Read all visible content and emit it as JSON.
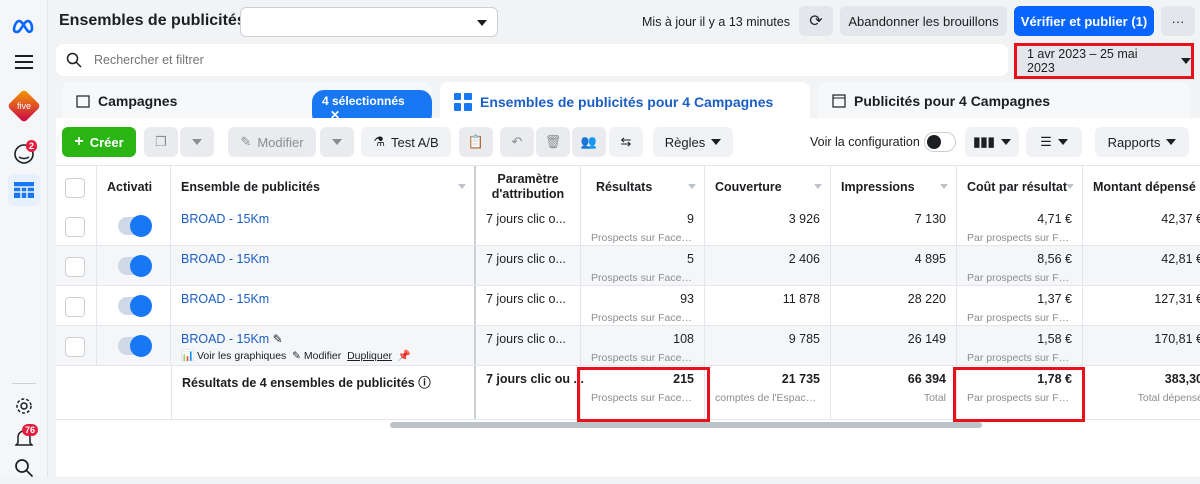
{
  "header": {
    "title": "Ensembles de publicités",
    "dropdown_value": "",
    "updated": "Mis à jour il y a 13 minutes",
    "discard": "Abandonner les brouillons",
    "publish": "Vérifier et publier (1)",
    "more": "···"
  },
  "sidebar": {
    "brand_label": "five",
    "notif_badge": "2",
    "alerts_badge": "76"
  },
  "search": {
    "placeholder": "Rechercher et filtrer"
  },
  "date_range": "1 avr 2023 – 25 mai 2023",
  "tabs": {
    "campaigns": "Campagnes",
    "selected": "4 sélectionnés",
    "adsets": "Ensembles de publicités pour 4 Campagnes",
    "ads": "Publicités pour 4 Campagnes"
  },
  "toolbar": {
    "create": "Créer",
    "edit": "Modifier",
    "ab_test": "Test A/B",
    "rules": "Règles",
    "view_config": "Voir la configuration",
    "reports": "Rapports"
  },
  "columns": {
    "activation": "Activati",
    "name": "Ensemble de publicités",
    "attribution": "Paramètre d'attribution",
    "results": "Résultats",
    "reach": "Couverture",
    "impressions": "Impressions",
    "cpr": "Coût par résultat",
    "spent": "Montant dépensé"
  },
  "rows": [
    {
      "name": "BROAD - 15Km",
      "attribution": "7 jours clic o...",
      "results": "9",
      "results_sub": "Prospects sur Faceb...",
      "reach": "3 926",
      "impressions": "7 130",
      "cpr": "4,71 €",
      "cpr_sub": "Par prospects sur Fa...",
      "spent": "42,37 €"
    },
    {
      "name": "BROAD - 15Km",
      "attribution": "7 jours clic o...",
      "results": "5",
      "results_sub": "Prospects sur Faceb...",
      "reach": "2 406",
      "impressions": "4 895",
      "cpr": "8,56 €",
      "cpr_sub": "Par prospects sur Fa...",
      "spent": "42,81 €"
    },
    {
      "name": "BROAD - 15Km",
      "attribution": "7 jours clic o...",
      "results": "93",
      "results_sub": "Prospects sur Faceb...",
      "reach": "11 878",
      "impressions": "28 220",
      "cpr": "1,37 €",
      "cpr_sub": "Par prospects sur Fa...",
      "spent": "127,31 €"
    },
    {
      "name": "BROAD - 15Km",
      "attribution": "7 jours clic o...",
      "results": "108",
      "results_sub": "Prospects sur Faceb...",
      "reach": "9 785",
      "impressions": "26 149",
      "cpr": "1,58 €",
      "cpr_sub": "Par prospects sur Fa...",
      "spent": "170,81 €"
    }
  ],
  "row_actions": {
    "charts": "Voir les graphiques",
    "edit": "Modifier",
    "duplicate": "Dupliquer"
  },
  "summary": {
    "label": "Résultats de 4 ensembles de publicités",
    "attribution": "7 jours clic ou ...",
    "results": "215",
    "results_sub": "Prospects sur Facebook",
    "reach": "21 735",
    "reach_sub": "comptes de l'Espace C...",
    "impressions": "66 394",
    "impressions_sub": "Total",
    "cpr": "1,78 €",
    "cpr_sub": "Par prospects sur Fac...",
    "spent": "383,30",
    "spent_sub": "Total dépensé"
  }
}
